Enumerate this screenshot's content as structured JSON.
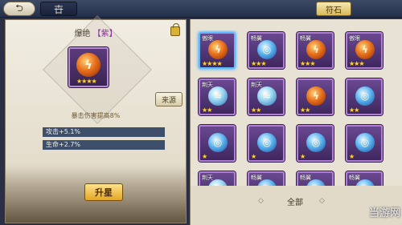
{
  "topbar": {
    "back_icon": "back-arrow-icon",
    "title_glyph": "卋",
    "fushi_tab": "符石"
  },
  "detail": {
    "title": "爆绝",
    "rarity": "【紫】",
    "stars": "★★★★",
    "source_button": "来源",
    "effect": "暴击伤害提高8%",
    "stats": [
      {
        "label": "攻击+5.1%"
      },
      {
        "label": "生命+2.7%"
      }
    ],
    "upgrade_button": "升星"
  },
  "grid": {
    "items": [
      {
        "label": "傲眼",
        "orb": "fire",
        "stars": "★★★★",
        "selected": true
      },
      {
        "label": "畅翼",
        "orb": "blue",
        "stars": "★★★",
        "selected": false
      },
      {
        "label": "畅翼",
        "orb": "fire",
        "stars": "★★★",
        "selected": false
      },
      {
        "label": "傲眼",
        "orb": "fire",
        "stars": "★★★",
        "selected": false
      },
      {
        "label": "荆天",
        "orb": "water",
        "stars": "★★",
        "selected": false
      },
      {
        "label": "荆天",
        "orb": "water",
        "stars": "★★",
        "selected": false
      },
      {
        "label": "",
        "orb": "fire",
        "stars": "★★",
        "selected": false
      },
      {
        "label": "",
        "orb": "blue",
        "stars": "★★",
        "selected": false
      },
      {
        "label": "",
        "orb": "blue",
        "stars": "★",
        "selected": false
      },
      {
        "label": "",
        "orb": "blue",
        "stars": "★",
        "selected": false
      },
      {
        "label": "",
        "orb": "blue",
        "stars": "★",
        "selected": false
      },
      {
        "label": "",
        "orb": "blue",
        "stars": "★",
        "selected": false
      },
      {
        "label": "荆天",
        "orb": "water",
        "stars": "",
        "selected": false
      },
      {
        "label": "畅翼",
        "orb": "blue",
        "stars": "",
        "selected": false
      },
      {
        "label": "畅翼",
        "orb": "blue",
        "stars": "",
        "selected": false
      },
      {
        "label": "畅翼",
        "orb": "blue",
        "stars": "",
        "selected": false
      }
    ],
    "filter_label": "全部"
  },
  "watermark": "当游网"
}
